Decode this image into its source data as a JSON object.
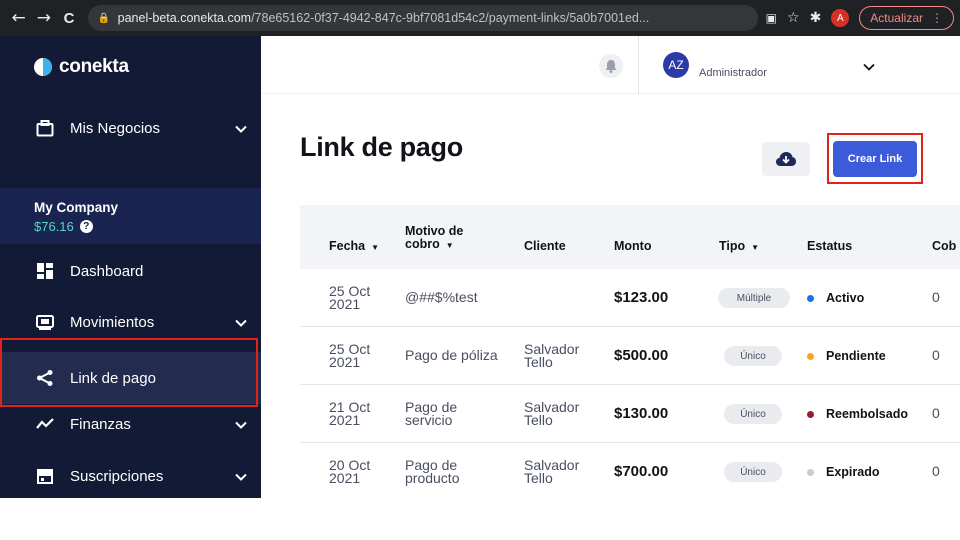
{
  "browser": {
    "back": "←",
    "forward": "→",
    "reload": "C",
    "url_host": "panel-beta.conekta.com",
    "url_path": "/78e65162-0f37-4942-847c-9bf7081d54c2/payment-links/5a0b7001ed...",
    "profile_initial": "A",
    "update_label": "Actualizar"
  },
  "sidebar": {
    "brand": "conekta",
    "business_label": "Mis Negocios",
    "company_name": "My Company",
    "company_balance": "$76.16",
    "items": [
      {
        "label": "Dashboard"
      },
      {
        "label": "Movimientos"
      },
      {
        "label": "Link de pago"
      },
      {
        "label": "Finanzas"
      },
      {
        "label": "Suscripciones"
      }
    ]
  },
  "header": {
    "avatar_initials": "AZ",
    "role": "Administrador"
  },
  "page": {
    "title": "Link de pago",
    "create_label": "Crear Link"
  },
  "table": {
    "headers": {
      "fecha": "Fecha",
      "motivo_line1": "Motivo de",
      "motivo_line2": "cobro",
      "cliente": "Cliente",
      "monto": "Monto",
      "tipo": "Tipo",
      "estatus": "Estatus",
      "cobros": "Cob"
    },
    "rows": [
      {
        "date1": "25 Oct",
        "date2": "2021",
        "concept1": "@##$%test",
        "concept2": "",
        "client1": "",
        "client2": "",
        "amount": "$123.00",
        "type": "Múltiple",
        "status": "Activo",
        "status_color": "#1f6fe5",
        "count": "0"
      },
      {
        "date1": "25 Oct",
        "date2": "2021",
        "concept1": "Pago de póliza",
        "concept2": "",
        "client1": "Salvador",
        "client2": "Tello",
        "amount": "$500.00",
        "type": "Único",
        "status": "Pendiente",
        "status_color": "#f5a623",
        "count": "0"
      },
      {
        "date1": "21 Oct",
        "date2": "2021",
        "concept1": "Pago de",
        "concept2": "servicio",
        "client1": "Salvador",
        "client2": "Tello",
        "amount": "$130.00",
        "type": "Único",
        "status": "Reembolsado",
        "status_color": "#9b1b30",
        "count": "0"
      },
      {
        "date1": "20 Oct",
        "date2": "2021",
        "concept1": "Pago de",
        "concept2": "producto",
        "client1": "Salvador",
        "client2": "Tello",
        "amount": "$700.00",
        "type": "Único",
        "status": "Expirado",
        "status_color": "#c9ccd3",
        "count": "0"
      }
    ]
  }
}
